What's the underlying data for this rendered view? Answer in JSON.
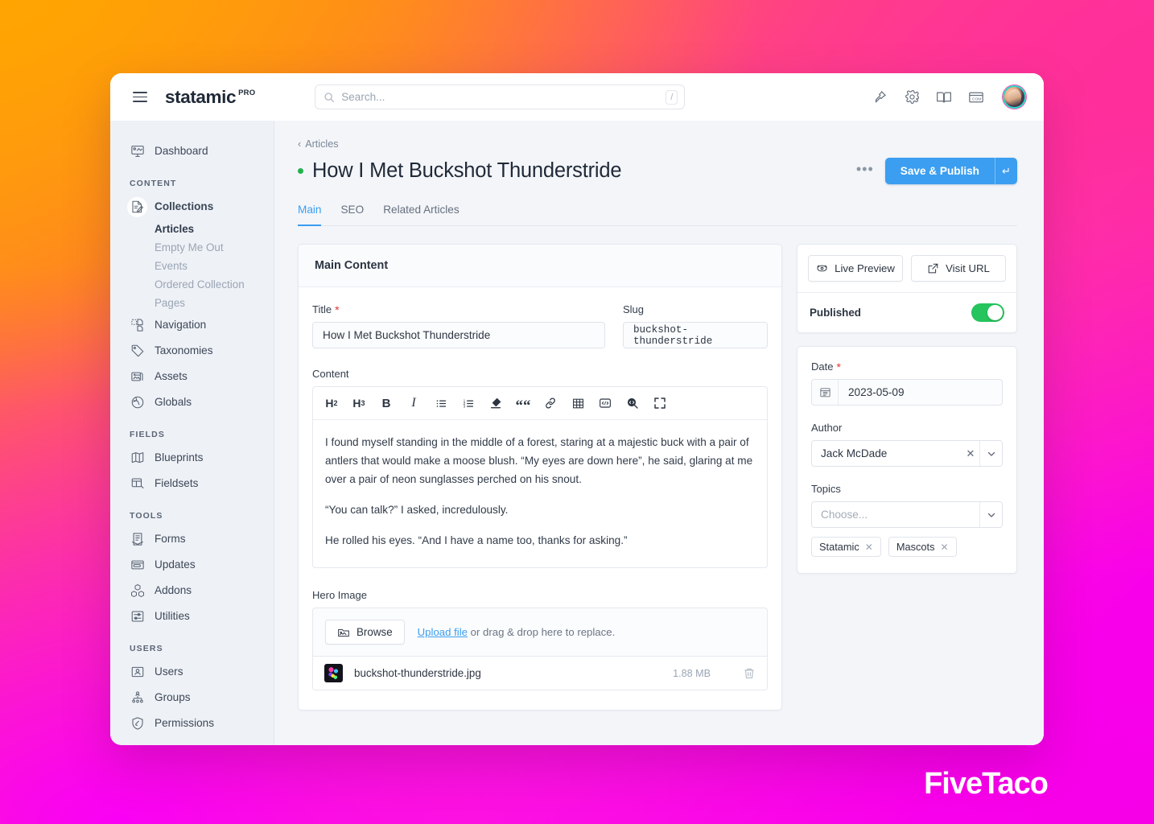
{
  "brand": {
    "name": "statamic",
    "edition": "PRO"
  },
  "search": {
    "placeholder": "Search...",
    "shortcut": "/"
  },
  "topbar": {
    "icons": [
      {
        "name": "pin-icon",
        "label": "Pin"
      },
      {
        "name": "gear-icon",
        "label": "Settings"
      },
      {
        "name": "book-icon",
        "label": "Documentation"
      },
      {
        "name": "site-com-icon",
        "label": ".COM"
      }
    ],
    "avatar_label": "User avatar"
  },
  "sidebar": {
    "top": [
      {
        "label": "Dashboard",
        "icon": "dashboard-icon"
      }
    ],
    "sections": [
      {
        "label": "CONTENT",
        "items": [
          {
            "label": "Collections",
            "icon": "collections-icon",
            "active": true,
            "children": [
              {
                "label": "Articles",
                "current": true
              },
              {
                "label": "Empty Me Out",
                "current": false
              },
              {
                "label": "Events",
                "current": false
              },
              {
                "label": "Ordered Collection",
                "current": false
              },
              {
                "label": "Pages",
                "current": false
              }
            ]
          },
          {
            "label": "Navigation",
            "icon": "navigation-icon"
          },
          {
            "label": "Taxonomies",
            "icon": "tag-icon"
          },
          {
            "label": "Assets",
            "icon": "assets-icon"
          },
          {
            "label": "Globals",
            "icon": "globe-icon"
          }
        ]
      },
      {
        "label": "FIELDS",
        "items": [
          {
            "label": "Blueprints",
            "icon": "blueprints-icon"
          },
          {
            "label": "Fieldsets",
            "icon": "fieldsets-icon"
          }
        ]
      },
      {
        "label": "TOOLS",
        "items": [
          {
            "label": "Forms",
            "icon": "forms-icon"
          },
          {
            "label": "Updates",
            "icon": "updates-icon"
          },
          {
            "label": "Addons",
            "icon": "addons-icon"
          },
          {
            "label": "Utilities",
            "icon": "utilities-icon"
          }
        ]
      },
      {
        "label": "USERS",
        "items": [
          {
            "label": "Users",
            "icon": "users-icon"
          },
          {
            "label": "Groups",
            "icon": "groups-icon"
          },
          {
            "label": "Permissions",
            "icon": "permissions-icon"
          }
        ]
      }
    ]
  },
  "page": {
    "breadcrumb": "Articles",
    "title": "How I Met Buckshot Thunderstride",
    "status_color": "#22b24c",
    "more_button": "•••",
    "save_label": "Save & Publish",
    "save_caret": "↵",
    "accent_color": "#3b9ef0",
    "tabs": [
      {
        "label": "Main",
        "active": true
      },
      {
        "label": "SEO",
        "active": false
      },
      {
        "label": "Related Articles",
        "active": false
      }
    ]
  },
  "main_content": {
    "card_title": "Main Content",
    "title_field": {
      "label": "Title",
      "required": true,
      "value": "How I Met Buckshot Thunderstride"
    },
    "slug_field": {
      "label": "Slug",
      "required": false,
      "value": "buckshot-thunderstride"
    },
    "content_field": {
      "label": "Content",
      "toolbar": [
        {
          "name": "heading-2-icon",
          "glyph": "H₂"
        },
        {
          "name": "heading-3-icon",
          "glyph": "H₃"
        },
        {
          "name": "bold-icon",
          "glyph": "B"
        },
        {
          "name": "italic-icon",
          "glyph": "I"
        },
        {
          "name": "bullet-list-icon",
          "glyph": ""
        },
        {
          "name": "ordered-list-icon",
          "glyph": ""
        },
        {
          "name": "eraser-icon",
          "glyph": ""
        },
        {
          "name": "blockquote-icon",
          "glyph": "“"
        },
        {
          "name": "link-icon",
          "glyph": ""
        },
        {
          "name": "table-icon",
          "glyph": ""
        },
        {
          "name": "code-block-icon",
          "glyph": ""
        },
        {
          "name": "inline-code-icon",
          "glyph": ""
        },
        {
          "name": "fullscreen-icon",
          "glyph": ""
        }
      ],
      "paragraphs": [
        "I found myself standing in the middle of a forest, staring at a majestic buck with a pair of antlers that would make a moose blush. “My eyes are down here”, he said, glaring at me over a pair of neon sunglasses perched on his snout.",
        "“You can talk?” I asked, incredulously.",
        "He rolled his eyes. “And I have a name too, thanks for asking.”"
      ]
    },
    "hero_image": {
      "label": "Hero Image",
      "browse_label": "Browse",
      "upload_link": "Upload file",
      "drop_text": " or drag & drop here to replace.",
      "file": {
        "name": "buckshot-thunderstride.jpg",
        "size": "1.88 MB"
      }
    }
  },
  "side_panel": {
    "live_preview_label": "Live Preview",
    "visit_url_label": "Visit URL",
    "published_label": "Published",
    "published_on": true,
    "toggle_color": "#25c45c",
    "date_field": {
      "label": "Date",
      "required": true,
      "value": "2023-05-09"
    },
    "author_field": {
      "label": "Author",
      "required": false,
      "value": "Jack McDade"
    },
    "topics_field": {
      "label": "Topics",
      "required": false,
      "placeholder": "Choose...",
      "tags": [
        "Statamic",
        "Mascots"
      ]
    }
  },
  "watermark": {
    "text": "FiveTaco"
  }
}
